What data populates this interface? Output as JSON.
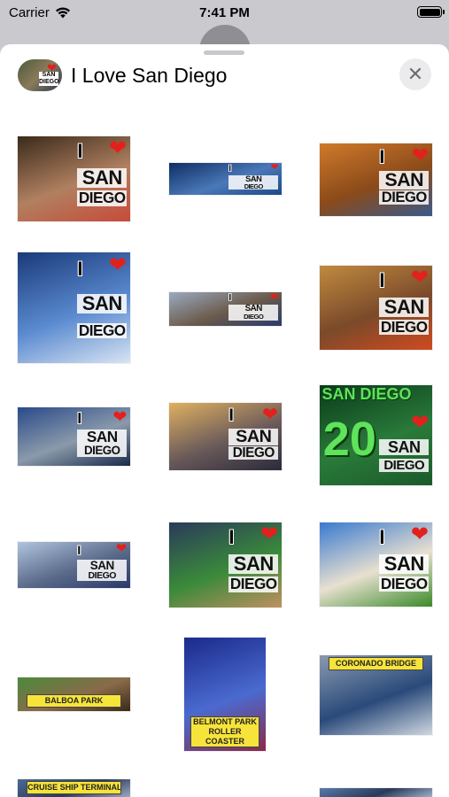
{
  "status_bar": {
    "carrier": "Carrier",
    "time": "7:41 PM"
  },
  "sheet": {
    "title": "I Love San Diego",
    "close_glyph": "✕",
    "app_icon": "i-love-san-diego-app-icon"
  },
  "art_text": {
    "i": "I",
    "heart": "❤",
    "san": "SAN",
    "diego": "DIEGO"
  },
  "stickers": [
    {
      "name": "sticker-gaslamp-plaza",
      "colors": [
        "#3a2a1a",
        "#b08060",
        "#c84a3a"
      ],
      "caption": ""
    },
    {
      "name": "sticker-skyline-bay",
      "colors": [
        "#0e2e62",
        "#4a78b8",
        "#1a4a8a"
      ],
      "caption": ""
    },
    {
      "name": "sticker-coastal-cliffs",
      "colors": [
        "#d07a2a",
        "#8a4a1a",
        "#3a5a8a"
      ],
      "caption": ""
    },
    {
      "name": "sticker-sailboats-waves",
      "colors": [
        "#1a3a7a",
        "#5a8ad0",
        "#d8e4f2"
      ],
      "caption": ""
    },
    {
      "name": "sticker-city-waterfront",
      "colors": [
        "#9aaac0",
        "#6a5a4a",
        "#2a3a6a"
      ],
      "caption": ""
    },
    {
      "name": "sticker-geisel-library",
      "colors": [
        "#c08a40",
        "#7a4a2a",
        "#d04a20"
      ],
      "caption": ""
    },
    {
      "name": "sticker-uss-midway",
      "colors": [
        "#2a4a8a",
        "#8a9aaa",
        "#1a2a4a"
      ],
      "caption": ""
    },
    {
      "name": "sticker-pier-sunset",
      "colors": [
        "#e0b060",
        "#6a5a5a",
        "#2a2a3a"
      ],
      "caption": ""
    },
    {
      "name": "sticker-san-diego-zoo",
      "colors": [
        "#0a3a1a",
        "#2a7a3a",
        "#1a5a2a"
      ],
      "caption": "",
      "green_top": "SAN DIEGO",
      "big": "20"
    },
    {
      "name": "sticker-bay-skyline",
      "colors": [
        "#b0c4de",
        "#5a6a8a",
        "#2a3a6a"
      ],
      "caption": ""
    },
    {
      "name": "sticker-petco-park",
      "colors": [
        "#2a3a5a",
        "#3a8a3a",
        "#c09060"
      ],
      "caption": ""
    },
    {
      "name": "sticker-mission-church",
      "colors": [
        "#3a7ad0",
        "#e8e0d0",
        "#3a8a2a"
      ],
      "caption": ""
    },
    {
      "name": "sticker-balboa-park",
      "colors": [
        "#4a8a3a",
        "#8a6a4a",
        "#3a2a1a"
      ],
      "caption": "BALBOA PARK"
    },
    {
      "name": "sticker-belmont-park-roller-coaster",
      "colors": [
        "#1a2a8a",
        "#4a6ad0",
        "#8a2a4a"
      ],
      "caption": "BELMONT PARK ROLLER COASTER"
    },
    {
      "name": "sticker-coronado-bridge",
      "colors": [
        "#8a9ab0",
        "#2a4a7a",
        "#d0d8e0"
      ],
      "caption": "CORONADO BRIDGE"
    },
    {
      "name": "sticker-cruise-ship-terminal",
      "colors": [
        "#4a6a9a",
        "#2a3a5a",
        "#9aaac0"
      ],
      "caption": "CRUISE SHIP TERMINAL"
    },
    {
      "name": "sticker-partial-bottom-right",
      "colors": [
        "#5a7aaa",
        "#2a3a5a",
        "#a0b0c8"
      ],
      "caption": ""
    }
  ]
}
